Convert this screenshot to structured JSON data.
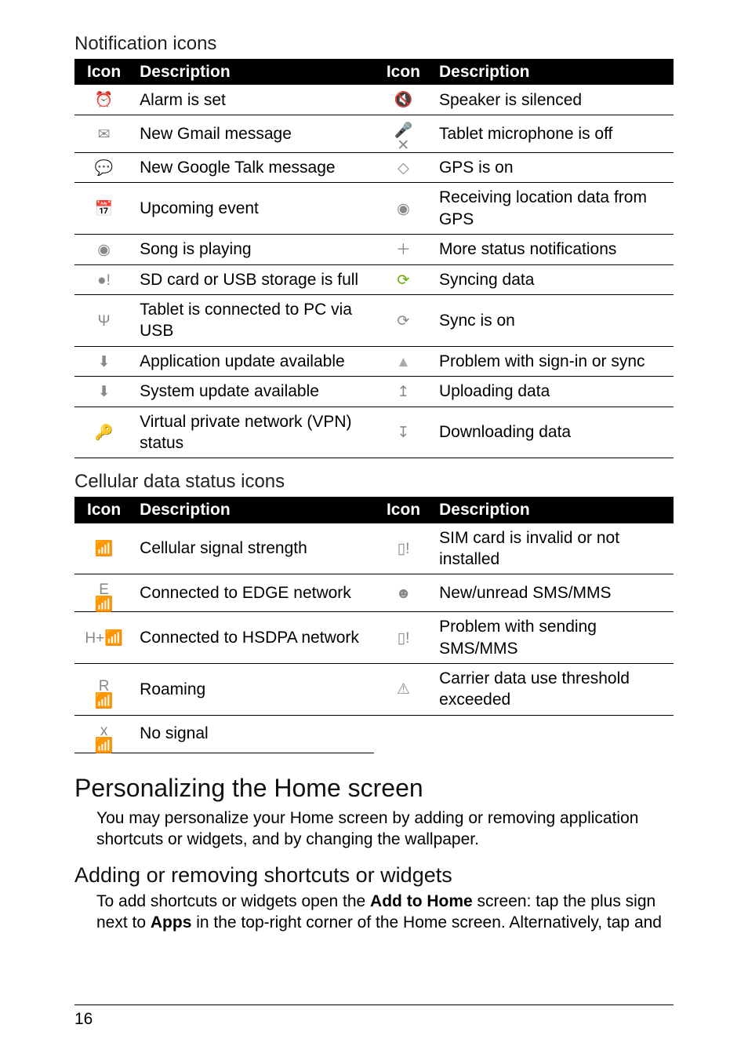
{
  "subheadings": {
    "notif": "Notification icons",
    "cell": "Cellular data status icons"
  },
  "headers": {
    "icon": "Icon",
    "desc": "Description"
  },
  "notif_rows": [
    {
      "li": "⏰",
      "ld": "Alarm is set",
      "ri": "🔇",
      "rd": "Speaker is silenced"
    },
    {
      "li": "✉",
      "ld": "New Gmail message",
      "ri": "🎤✕",
      "rd": "Tablet microphone is off"
    },
    {
      "li": "💬",
      "ld": "New Google Talk message",
      "ri": "◇",
      "rd": "GPS is on"
    },
    {
      "li": "📅",
      "ld": "Upcoming event",
      "ri": "◉",
      "rd": "Receiving location data from GPS"
    },
    {
      "li": "◉",
      "ld": "Song is playing",
      "ri": "＋",
      "rd": "More status notifications"
    },
    {
      "li": "●!",
      "ld": "SD card or USB storage is full",
      "ri": "⟳",
      "rd": "Syncing data",
      "ri_cls": "icon-green"
    },
    {
      "li": "Ψ",
      "ld": "Tablet is connected to PC via USB",
      "ri": "⟳",
      "rd": "Sync is on"
    },
    {
      "li": "⬇",
      "ld": "Application update available",
      "ri": "▲",
      "rd": "Problem with sign-in or sync",
      "ri_cls": "icon-warn"
    },
    {
      "li": "⬇",
      "ld": "System update available",
      "ri": "↥",
      "rd": "Uploading data"
    },
    {
      "li": "🔑",
      "ld": "Virtual private network (VPN) status",
      "ri": "↧",
      "rd": "Downloading data"
    }
  ],
  "cell_rows": [
    {
      "li": "📶",
      "ld": "Cellular signal strength",
      "ri": "▯!",
      "rd": "SIM card is invalid or not installed"
    },
    {
      "li": "E📶",
      "ld": "Connected to EDGE network",
      "ri": "☻",
      "rd": "New/unread SMS/MMS"
    },
    {
      "li": "H+📶",
      "ld": "Connected to HSDPA network",
      "ri": "▯!",
      "rd": "Problem with sending SMS/MMS"
    },
    {
      "li": "R📶",
      "ld": "Roaming",
      "ri": "⚠",
      "rd": "Carrier data use threshold exceeded"
    },
    {
      "li": "x📶",
      "ld": "No signal",
      "ri": "",
      "rd": ""
    }
  ],
  "section1": {
    "heading": "Personalizing the Home screen",
    "body": "You may personalize your Home screen by adding or removing application shortcuts or widgets, and by changing the wallpaper."
  },
  "section2": {
    "heading": "Adding or removing shortcuts or widgets",
    "body_pre": "To add shortcuts or widgets open the ",
    "bold1": "Add to Home",
    "body_mid": " screen: tap the plus sign next to ",
    "bold2": "Apps",
    "body_post": " in the top-right corner of the Home screen. Alternatively, tap and"
  },
  "page_number": "16"
}
